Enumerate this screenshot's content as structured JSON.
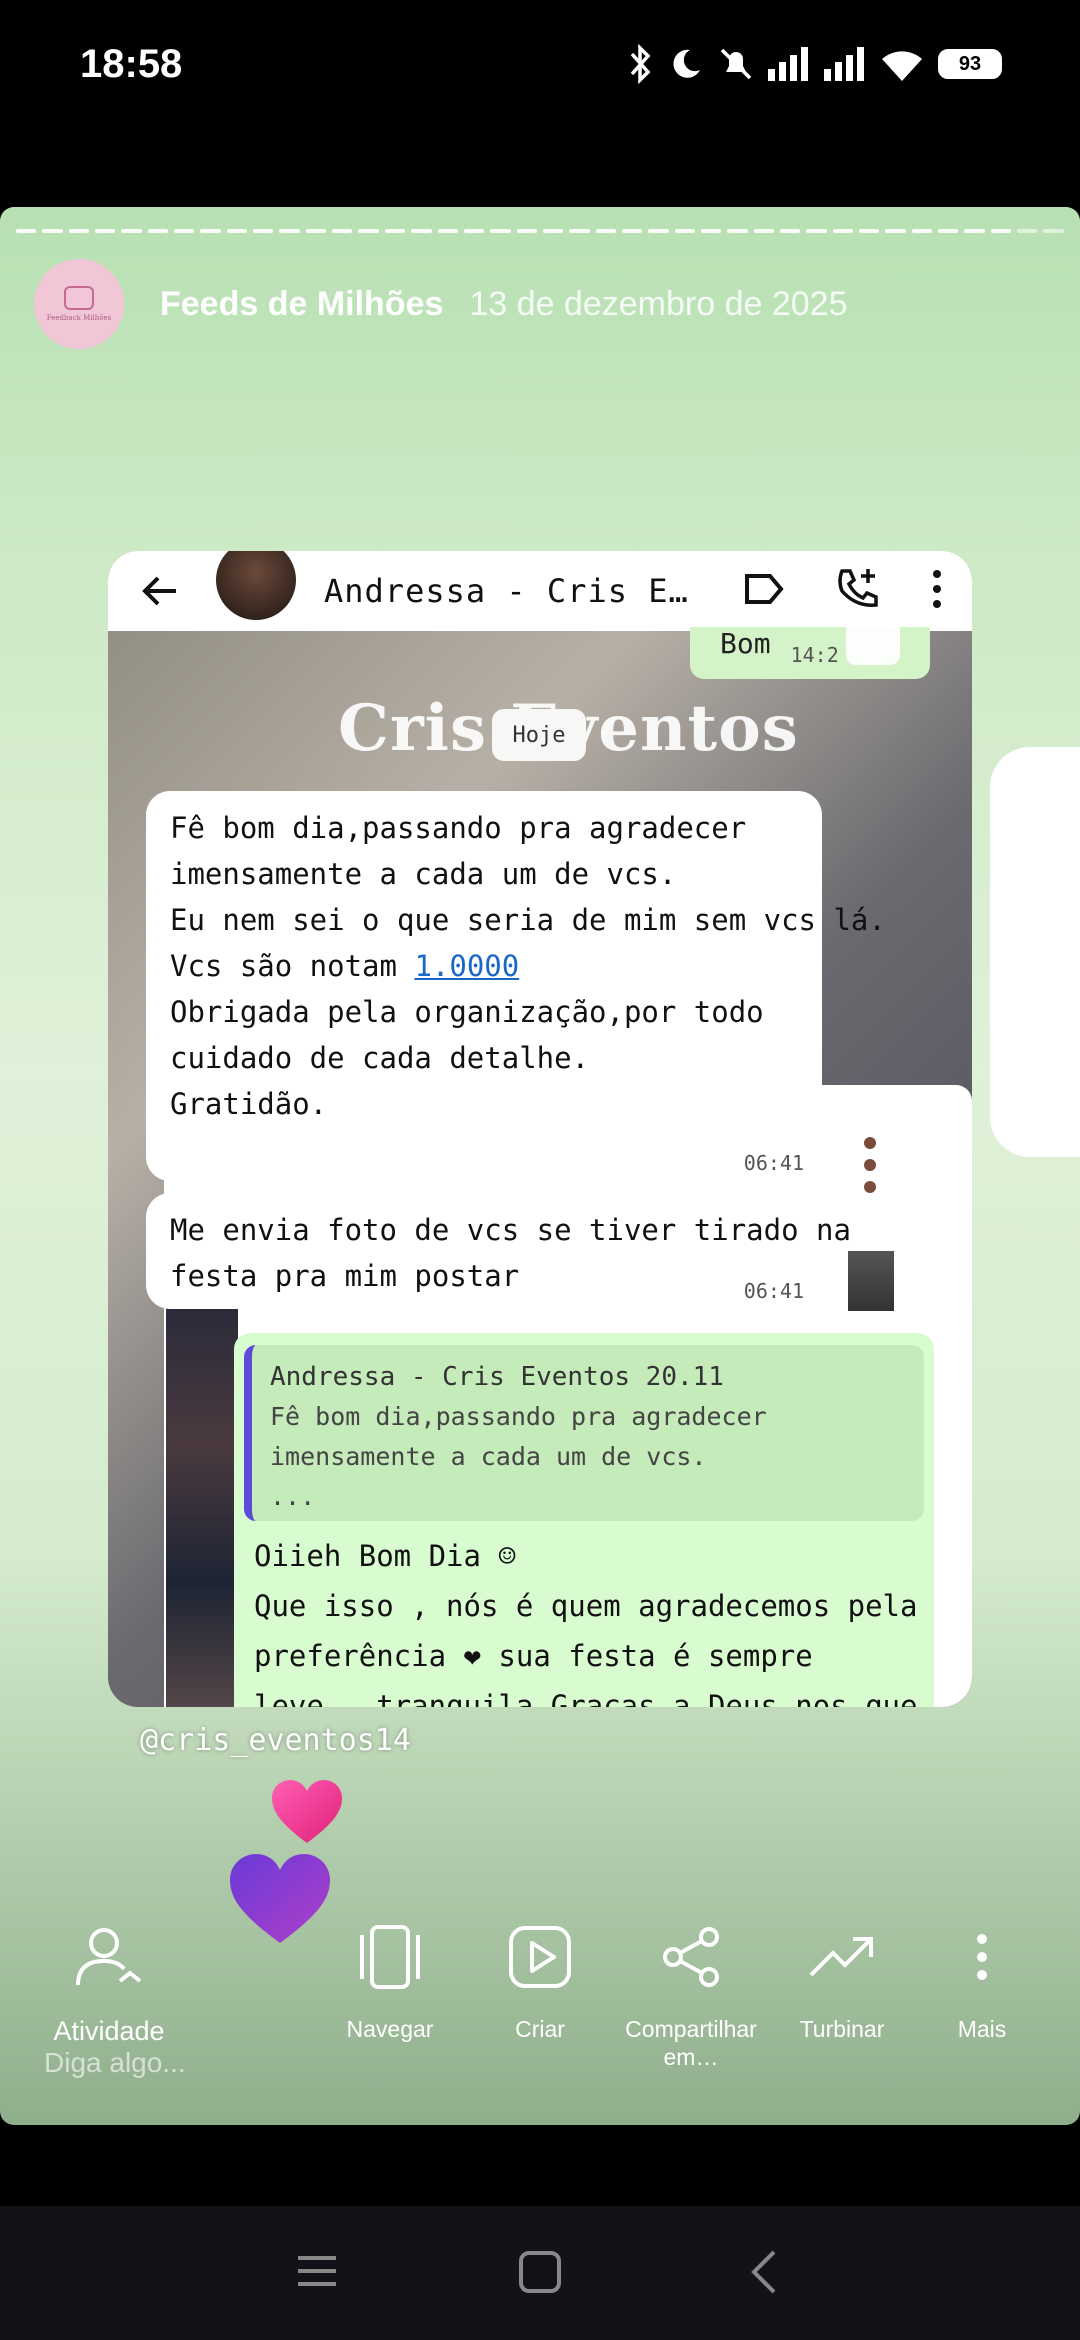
{
  "status_bar": {
    "time": "18:58",
    "battery": "93"
  },
  "story": {
    "user": "Feeds de Milhões",
    "date": "13 de dezembro de 2025",
    "avatar_brand": "Feedback Milhões",
    "mention": "@cris_eventos14",
    "reply_placeholder": "Diga algo..."
  },
  "whatsapp": {
    "contact_name": "Andressa - Cris E…",
    "cover_text": "Cris Eventos",
    "today_label": "Hoje",
    "previous_message": "Bom",
    "previous_time": "14:2",
    "message1": {
      "lines": [
        "Fê bom dia,passando pra agradecer",
        "imensamente a cada um de vcs.",
        "",
        "Eu nem sei o que seria de mim sem vcs lá.",
        "Vcs são notam ",
        "Obrigada pela organização,por todo",
        "cuidado de cada detalhe.",
        "Gratidão."
      ],
      "link": "1.0000",
      "time": "06:41"
    },
    "message2": {
      "lines": [
        "Me envia foto de vcs se tiver tirado na",
        "festa pra mim postar"
      ],
      "time": "06:41"
    },
    "reply": {
      "quote_author": "Andressa - Cris Eventos 20.11",
      "quote_text": "Fê bom dia,passando pra agradecer\nimensamente a cada um de vcs.\n...",
      "lines": [
        "Oiieh Bom Dia ☺",
        "Que isso , nós é quem agradecemos pela",
        "preferência ❤ sua festa é sempre",
        "leve , tranquila Graças a Deus nos que"
      ]
    }
  },
  "actions": [
    {
      "id": "activity",
      "label": "Atividade"
    },
    {
      "id": "navigate",
      "label": "Navegar"
    },
    {
      "id": "create",
      "label": "Criar"
    },
    {
      "id": "share",
      "label": "Compartilhar em…"
    },
    {
      "id": "boost",
      "label": "Turbinar"
    },
    {
      "id": "more",
      "label": "Mais"
    }
  ],
  "colors": {
    "story_gradient_top": "#b8e0b3",
    "bubble_out": "#d9fbd0",
    "quote_bar": "#5b4bd6",
    "heart_pink": "#ff3fa0",
    "heart_purple": "#8e3fd0"
  }
}
